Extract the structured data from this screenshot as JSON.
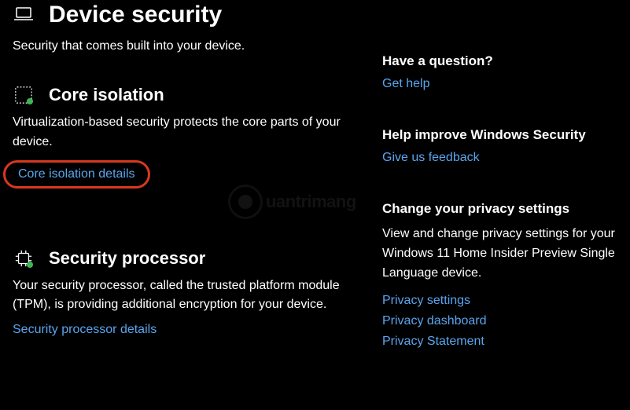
{
  "page": {
    "title": "Device security",
    "subtitle": "Security that comes built into your device."
  },
  "core_isolation": {
    "title": "Core isolation",
    "desc": "Virtualization-based security protects the core parts of your device.",
    "details_link": "Core isolation details"
  },
  "security_processor": {
    "title": "Security processor",
    "desc": "Your security processor, called the trusted platform module (TPM), is providing additional encryption for your device.",
    "details_link": "Security processor details"
  },
  "side": {
    "question": {
      "heading": "Have a question?",
      "link": "Get help"
    },
    "improve": {
      "heading": "Help improve Windows Security",
      "link": "Give us feedback"
    },
    "privacy": {
      "heading": "Change your privacy settings",
      "desc": "View and change privacy settings for your Windows 11 Home Insider Preview Single Language device.",
      "link_settings": "Privacy settings",
      "link_dashboard": "Privacy dashboard",
      "link_statement": "Privacy Statement"
    }
  },
  "watermark": "uantrimang"
}
